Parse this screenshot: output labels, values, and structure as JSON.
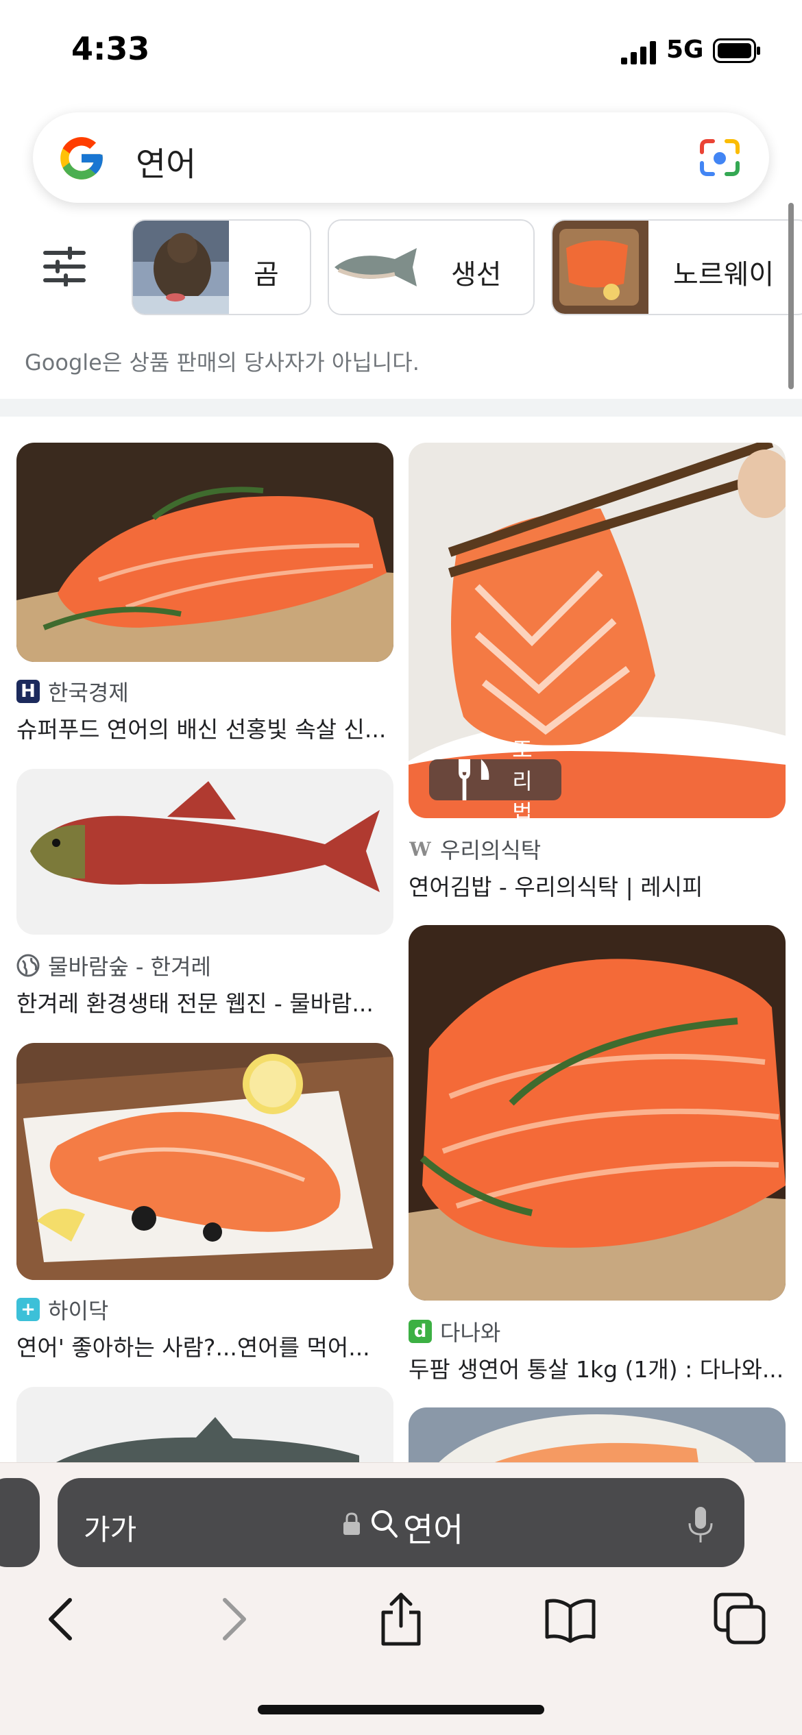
{
  "status": {
    "time": "4:33",
    "network": "5G"
  },
  "search": {
    "query": "연어"
  },
  "chips": [
    {
      "label": "곰"
    },
    {
      "label": "생선"
    },
    {
      "label": "노르웨이"
    }
  ],
  "disclaimer": "Google은 상품 판매의 당사자가 아닙니다.",
  "results": {
    "left": [
      {
        "source": "한국경제",
        "title": "슈퍼푸드 연어의 배신 선홍빛 속살 신..."
      },
      {
        "source": "물바람숲 - 한겨레",
        "title": "한겨레 환경생태 전문 웹진 - 물바람..."
      },
      {
        "source": "하이닥",
        "title": "연어' 좋아하는 사람?...연어를 먹어..."
      }
    ],
    "right": [
      {
        "badge": "조리법",
        "source": "우리의식탁",
        "title": "연어김밥 - 우리의식탁 | 레시피"
      },
      {
        "source": "다나와",
        "title": "두팜 생연어 통살 1kg (1개) : 다나와..."
      }
    ]
  },
  "browser": {
    "text_size": "가가",
    "url": "연어"
  },
  "icons": {
    "signal": "signal-icon",
    "battery": "battery-icon",
    "google": "google-logo-icon",
    "lens": "google-lens-icon",
    "filter": "tune-icon",
    "lock": "lock-icon",
    "search": "search-icon",
    "mic": "mic-icon",
    "back": "chevron-left-icon",
    "forward": "chevron-right-icon",
    "share": "share-icon",
    "bookmarks": "book-icon",
    "tabs": "tabs-icon",
    "recipe": "fork-knife-icon"
  }
}
